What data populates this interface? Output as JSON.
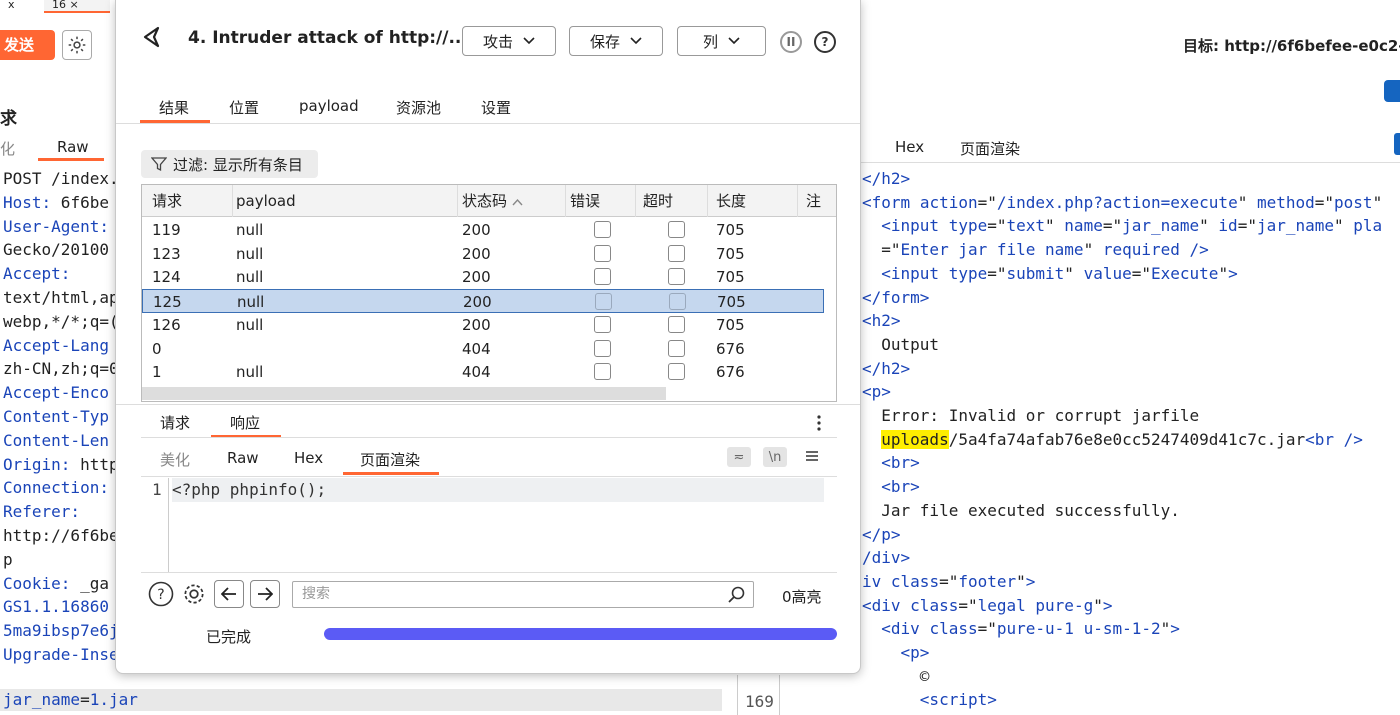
{
  "top_tabs": [
    "x",
    "16 ×"
  ],
  "left": {
    "send_label": "发送",
    "request_title": "求",
    "tabs": [
      "化",
      "Raw"
    ],
    "request_lines": [
      {
        "h": "",
        "v": "POST /index."
      },
      {
        "h": "Host:",
        "v": " 6f6be"
      },
      {
        "h": "User-Agent:",
        "v": ""
      },
      {
        "h": "",
        "v": "Gecko/20100"
      },
      {
        "h": "Accept:",
        "v": ""
      },
      {
        "h": "",
        "v": "text/html,ap"
      },
      {
        "h": "",
        "v": "webp,*/*;q=("
      },
      {
        "h": "Accept-Lang",
        "v": ""
      },
      {
        "h": "",
        "v": "zh-CN,zh;q=0"
      },
      {
        "h": "Accept-Enco",
        "v": ""
      },
      {
        "h": "Content-Typ",
        "v": ""
      },
      {
        "h": "Content-Len",
        "v": ""
      },
      {
        "h": "Origin:",
        "v": " http"
      },
      {
        "h": "Connection:",
        "v": ""
      },
      {
        "h": "Referer:",
        "v": ""
      },
      {
        "h": "",
        "v": "http://6f6be"
      },
      {
        "h": "",
        "v": "p"
      },
      {
        "h": "Cookie:",
        "v": " _ga"
      },
      {
        "h": "GS1.1.16860",
        "v": ""
      },
      {
        "h": "5ma9ibsp7e6j",
        "v": ""
      },
      {
        "h": "Upgrade-Inse",
        "v": ""
      }
    ],
    "jar_key": "jar_name",
    "jar_eq": "=",
    "jar_val": "1.jar",
    "line_169": "169"
  },
  "right": {
    "target": "目标: http://6f6befee-e0c2-43",
    "tabs": [
      "Hex",
      "页面渲染"
    ]
  },
  "dialog": {
    "title": "4. Intruder attack of http://...",
    "buttons": {
      "attack": "攻击",
      "save": "保存",
      "columns": "列"
    },
    "tabs": [
      "结果",
      "位置",
      "payload",
      "资源池",
      "设置"
    ],
    "filter": "过滤: 显示所有条目",
    "table": {
      "headers": [
        "请求",
        "payload",
        "状态码",
        "错误",
        "超时",
        "长度",
        "注"
      ],
      "rows": [
        {
          "req": "119",
          "payload": "null",
          "status": "200",
          "len": "705"
        },
        {
          "req": "123",
          "payload": "null",
          "status": "200",
          "len": "705"
        },
        {
          "req": "124",
          "payload": "null",
          "status": "200",
          "len": "705"
        },
        {
          "req": "125",
          "payload": "null",
          "status": "200",
          "len": "705"
        },
        {
          "req": "126",
          "payload": "null",
          "status": "200",
          "len": "705"
        },
        {
          "req": "0",
          "payload": "",
          "status": "404",
          "len": "676"
        },
        {
          "req": "1",
          "payload": "null",
          "status": "404",
          "len": "676"
        }
      ],
      "selected_index": 3
    },
    "pane_tabs": [
      "请求",
      "响应"
    ],
    "view_tabs": [
      "美化",
      "Raw",
      "Hex",
      "页面渲染"
    ],
    "editor": {
      "line_no": "1",
      "code": "<?php phpinfo();"
    },
    "search_placeholder": "搜索",
    "highlights": "0高亮",
    "status": "已完成",
    "progress_fraction": 1.0
  },
  "colors": {
    "accent": "#ff6633",
    "progress": "#5b5bf5",
    "selected_row": "#c5d7ee",
    "code_blue": "#1a44b8",
    "highlight": "#ffee00"
  }
}
